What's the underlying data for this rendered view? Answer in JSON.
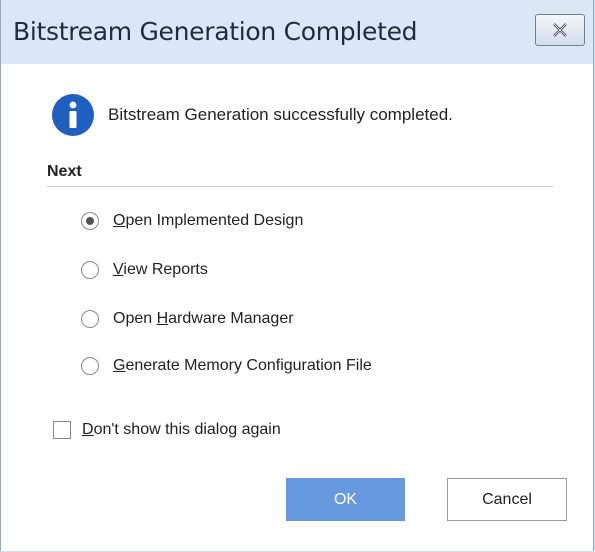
{
  "dialog": {
    "title": "Bitstream Generation Completed",
    "message": "Bitstream Generation successfully completed.",
    "icon": "info-icon",
    "accent_color": "#1f5fbf",
    "next_label": "Next",
    "options": [
      {
        "pre": "",
        "key": "O",
        "post": "pen Implemented Design",
        "selected": true
      },
      {
        "pre": "",
        "key": "V",
        "post": "iew Reports",
        "selected": false
      },
      {
        "pre": "Open ",
        "key": "H",
        "post": "ardware Manager",
        "selected": false
      },
      {
        "pre": "",
        "key": "G",
        "post": "enerate Memory Configuration File",
        "selected": false
      }
    ],
    "dont_show": {
      "key": "D",
      "post": "on't show this dialog again",
      "checked": false
    },
    "ok_label": "OK",
    "cancel_label": "Cancel",
    "ok_color": "#6699dd"
  }
}
